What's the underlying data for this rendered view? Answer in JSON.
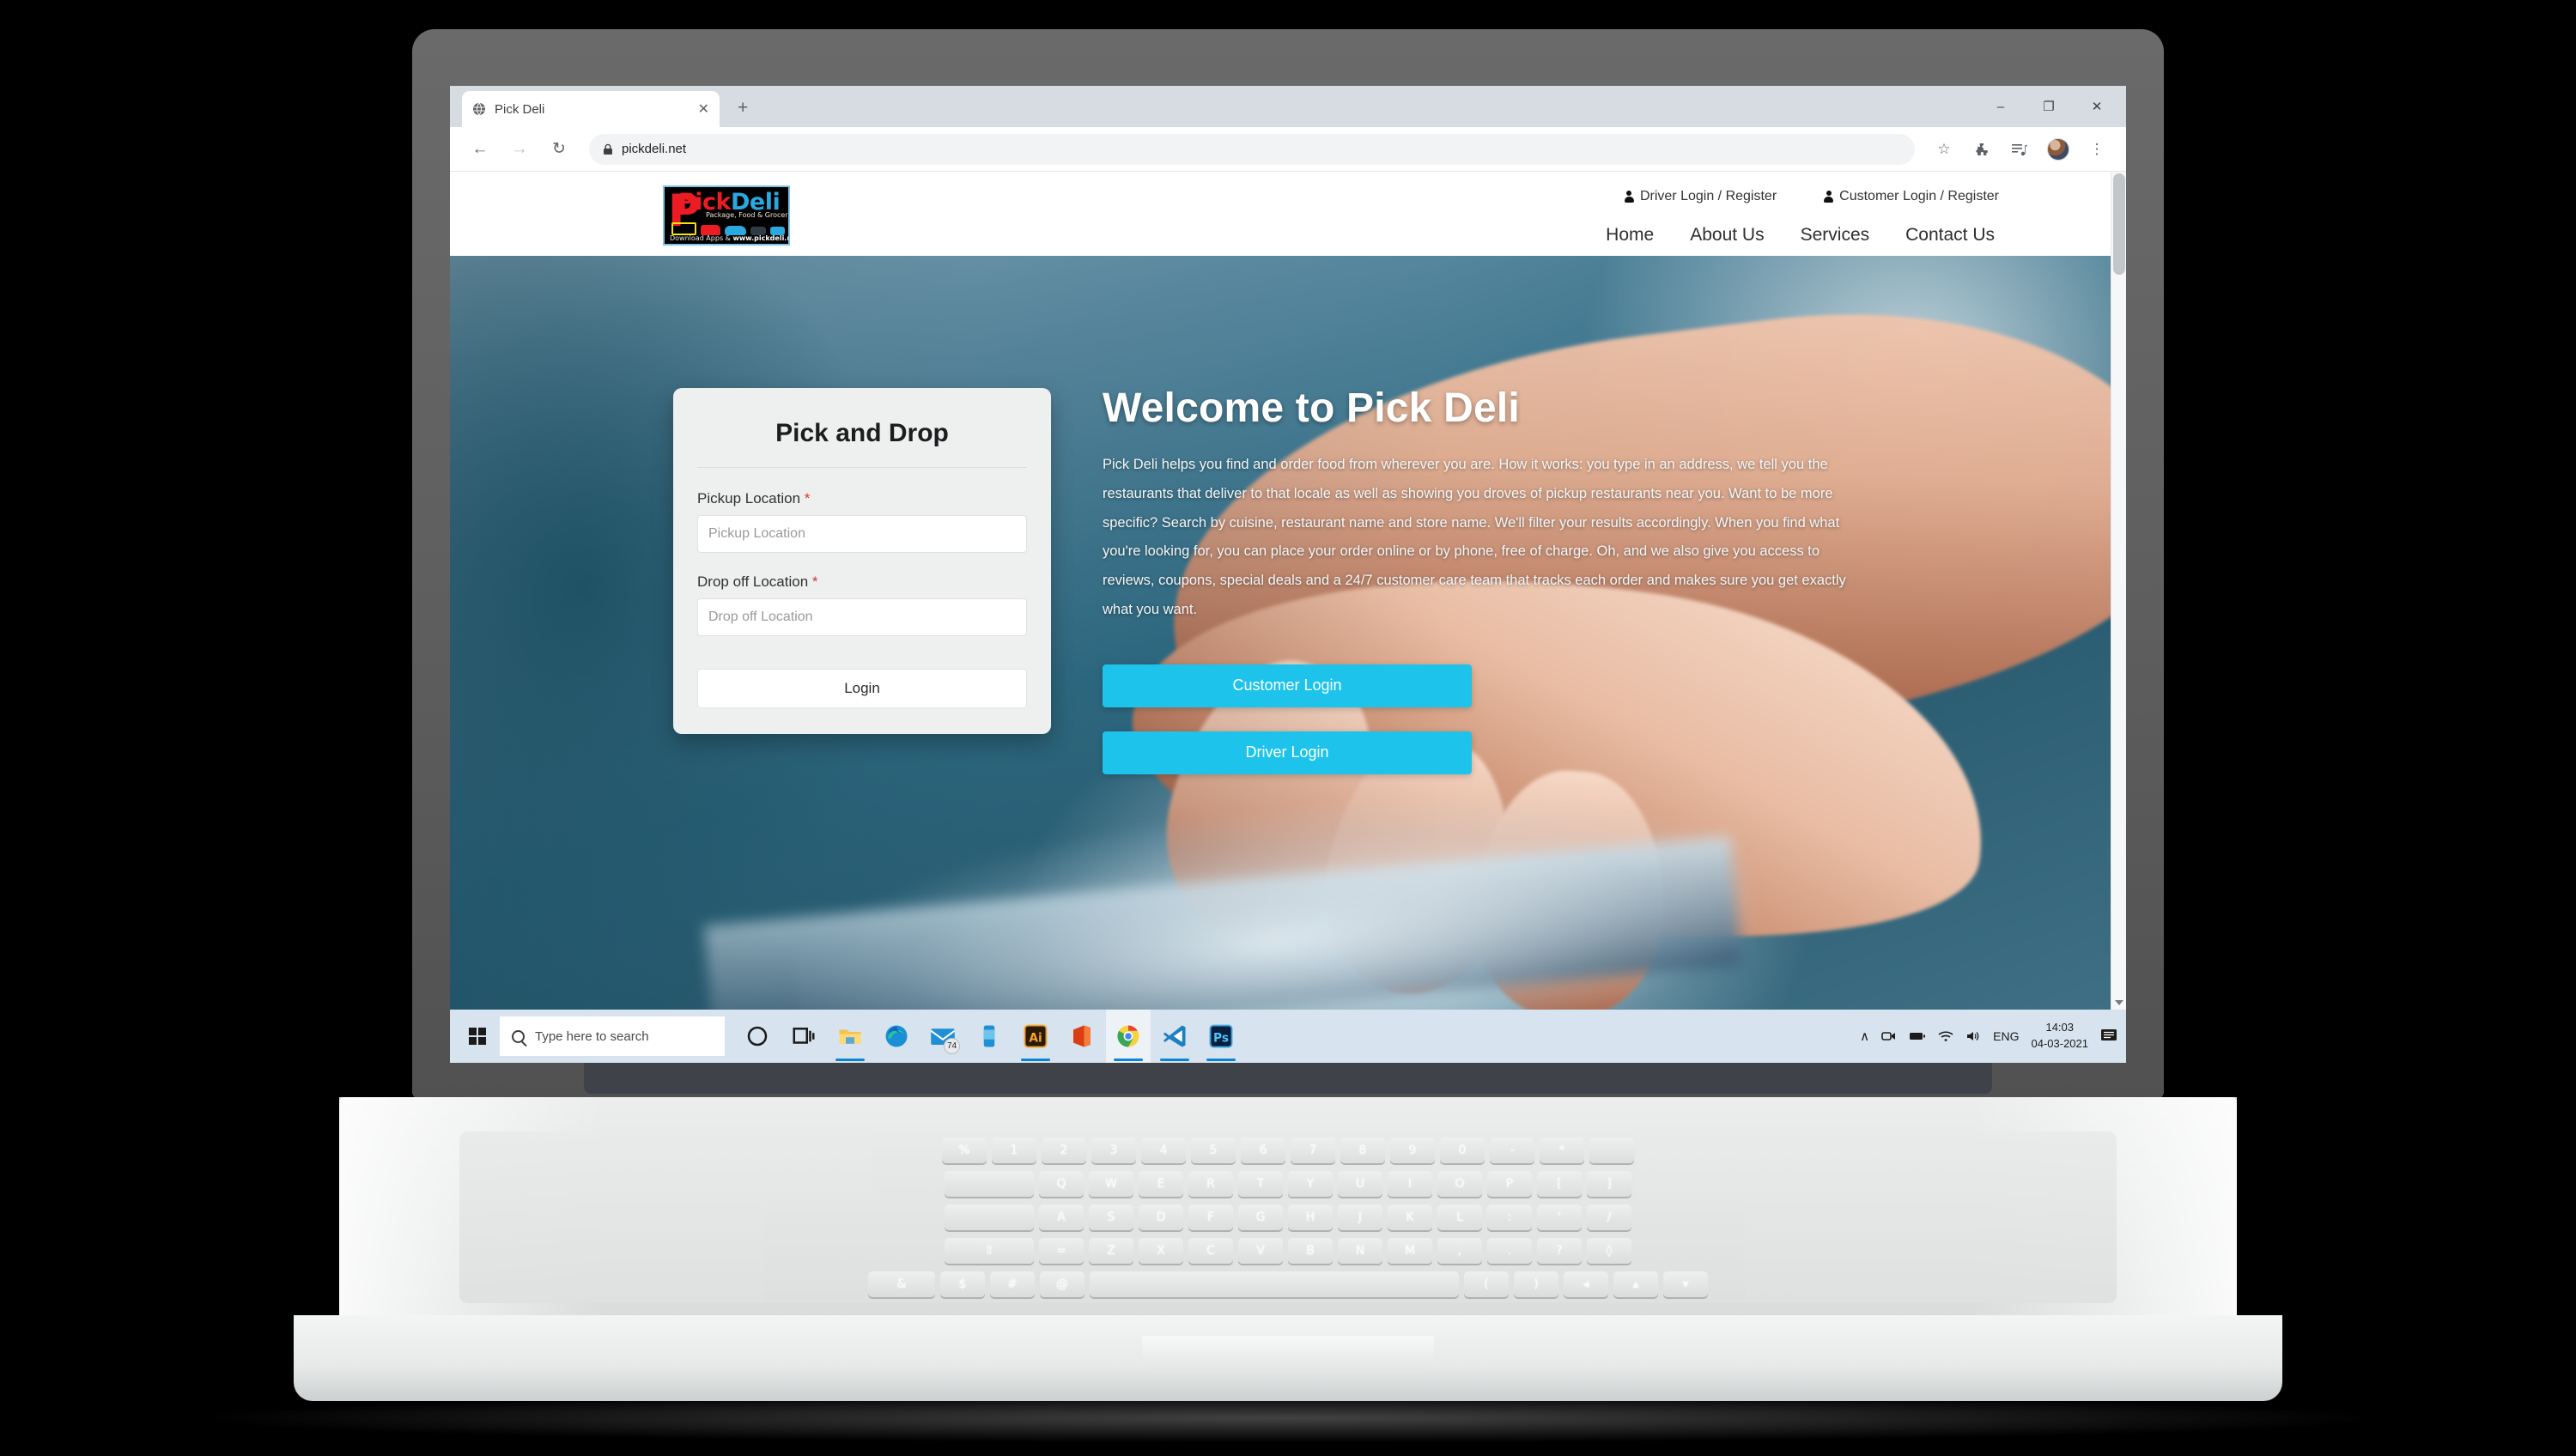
{
  "browser": {
    "tab": {
      "title": "Pick Deli",
      "favicon": "globe-icon",
      "close": "✕"
    },
    "new_tab": "+",
    "window_controls": {
      "minimize": "–",
      "maximize": "❐",
      "close": "✕"
    },
    "nav": {
      "back": "←",
      "forward": "→",
      "reload": "↻"
    },
    "omnibox": {
      "lock": "🔒",
      "url": "pickdeli.net"
    },
    "toolbar": {
      "bookmark": "☆",
      "extensions": "puzzle-icon",
      "media": "media-list-icon",
      "menu": "⋮"
    }
  },
  "site": {
    "logo": {
      "big_letter": "P",
      "word_pick": "Pick",
      "word_deli": "Deli",
      "tagline": "Package, Food & Grocery",
      "footer_pre": "Download Apps & ",
      "footer_url": "www.pickdeli.net"
    },
    "top_links": [
      {
        "label": "Driver Login / Register",
        "icon": "person-icon"
      },
      {
        "label": "Customer Login / Register",
        "icon": "person-icon"
      }
    ],
    "nav_items": [
      "Home",
      "About Us",
      "Services",
      "Contact Us"
    ]
  },
  "form": {
    "title": "Pick and Drop",
    "required_mark": "*",
    "pickup": {
      "label": "Pickup Location",
      "placeholder": "Pickup Location",
      "value": ""
    },
    "dropoff": {
      "label": "Drop off Location",
      "placeholder": "Drop off Location",
      "value": ""
    },
    "submit_label": "Login"
  },
  "hero": {
    "heading": "Welcome to Pick Deli",
    "paragraph": "Pick Deli helps you find and order food from wherever you are. How it works: you type in an address, we tell you the restaurants that deliver to that locale as well as showing you droves of pickup restaurants near you. Want to be more specific? Search by cuisine, restaurant name and store name. We'll filter your results accordingly. When you find what you're looking for, you can place your order online or by phone, free of charge. Oh, and we also give you access to reviews, coupons, special deals and a 24/7 customer care team that tracks each order and makes sure you get exactly what you want.",
    "cta_customer": "Customer Login",
    "cta_driver": "Driver Login",
    "accent_color": "#1ec3ec"
  },
  "taskbar": {
    "start": "windows-logo-icon",
    "search_placeholder": "Type here to search",
    "apps": [
      {
        "name": "cortana-icon",
        "label": "O"
      },
      {
        "name": "task-view-icon",
        "label": "task-view"
      },
      {
        "name": "file-explorer-icon",
        "label": "File Explorer"
      },
      {
        "name": "microsoft-edge-icon",
        "label": "Microsoft Edge"
      },
      {
        "name": "mail-icon",
        "label": "Mail",
        "badge": "74"
      },
      {
        "name": "your-phone-icon",
        "label": "Your Phone"
      },
      {
        "name": "illustrator-icon",
        "label": "Ai"
      },
      {
        "name": "microsoft-office-icon",
        "label": "Office"
      },
      {
        "name": "google-chrome-icon",
        "label": "Google Chrome"
      },
      {
        "name": "vs-code-icon",
        "label": "Visual Studio Code"
      },
      {
        "name": "photoshop-icon",
        "label": "Ps"
      }
    ],
    "tray": {
      "chevron": "∧",
      "icons": [
        "camera-icon",
        "battery-icon",
        "wifi-icon",
        "volume-icon"
      ],
      "language": "ENG",
      "time": "14:03",
      "date": "04-03-2021",
      "action_center": "action-center-icon"
    }
  },
  "keyboard": {
    "row1": [
      "%",
      "1",
      "2",
      "3",
      "4",
      "5",
      "6",
      "7",
      "8",
      "9",
      "0",
      "-",
      "*",
      ""
    ],
    "row2": [
      "",
      "Q",
      "W",
      "E",
      "R",
      "T",
      "Y",
      "U",
      "I",
      "O",
      "P",
      "[",
      "]"
    ],
    "row3": [
      "",
      "A",
      "S",
      "D",
      "F",
      "G",
      "H",
      "J",
      "K",
      "L",
      ":",
      "'",
      "/"
    ],
    "row4": [
      "⇧",
      "=",
      "Z",
      "X",
      "C",
      "V",
      "B",
      "N",
      "M",
      ",",
      ".",
      "?",
      "◊"
    ],
    "row5": [
      "&",
      "$",
      "#",
      "@",
      "",
      "(",
      ")",
      "◂",
      "▴",
      "▾"
    ]
  }
}
